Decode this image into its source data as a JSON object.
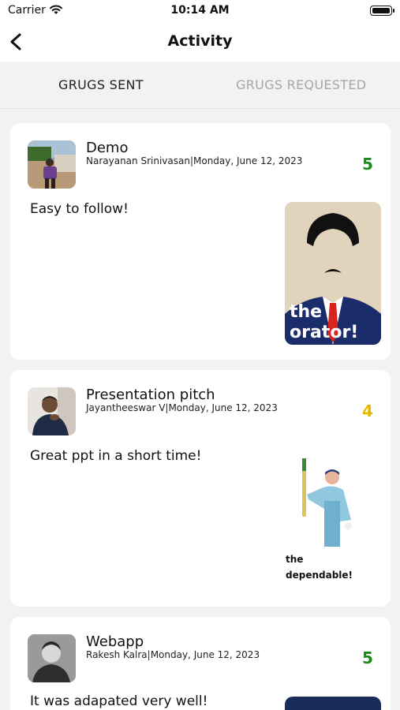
{
  "status_bar": {
    "carrier": "Carrier",
    "time": "10:14 AM"
  },
  "nav": {
    "title": "Activity"
  },
  "tabs": [
    {
      "label": "GRUGS SENT",
      "active": true
    },
    {
      "label": "GRUGS REQUESTED",
      "active": false
    }
  ],
  "cards": [
    {
      "title": "Demo",
      "author": "Narayanan Srinivasan",
      "date": "Monday, June 12, 2023",
      "rating": "5",
      "rating_color": "#1a8a1a",
      "comment": "Easy to follow!",
      "badge_line1": "the",
      "badge_line2": "orator!"
    },
    {
      "title": "Presentation pitch",
      "author": "Jayantheeswar V",
      "date": "Monday, June 12, 2023",
      "rating": "4",
      "rating_color": "#e6b800",
      "comment": "Great ppt in a short time!",
      "badge_line1": "the",
      "badge_line2": "dependable!"
    },
    {
      "title": "Webapp",
      "author": "Rakesh Kalra",
      "date": "Monday, June 12, 2023",
      "rating": "5",
      "rating_color": "#1a8a1a",
      "comment": "It was adapated very well!"
    }
  ]
}
